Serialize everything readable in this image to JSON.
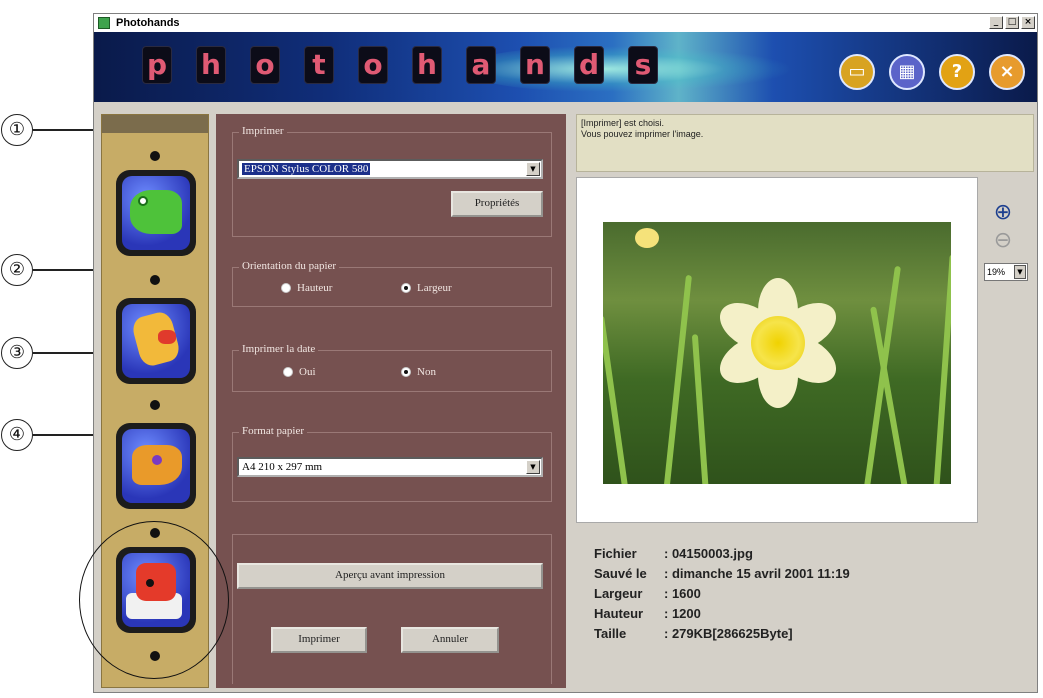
{
  "window": {
    "title": "Photohands",
    "controls": {
      "minimize": "_",
      "maximize": "□",
      "close": "×"
    }
  },
  "banner": {
    "logo_letters": [
      "p",
      "h",
      "o",
      "t",
      "o",
      "h",
      "a",
      "n",
      "d",
      "s"
    ],
    "tools": [
      {
        "name": "open-folder-icon",
        "glyph": "▭",
        "color": "#d8a321"
      },
      {
        "name": "save-icon",
        "glyph": "▦",
        "color": "#5b64c9"
      },
      {
        "name": "help-icon",
        "glyph": "?",
        "color": "#e2a214"
      },
      {
        "name": "close-icon",
        "glyph": "×",
        "color": "#e79b2d"
      }
    ]
  },
  "callouts": [
    "①",
    "②",
    "③",
    "④"
  ],
  "print_panel": {
    "printer": {
      "label": "Imprimer",
      "selected": "EPSON Stylus COLOR 580",
      "properties_button": "Propriétés"
    },
    "orientation": {
      "label": "Orientation du papier",
      "options": [
        "Hauteur",
        "Largeur"
      ],
      "selected": "Largeur"
    },
    "print_date": {
      "label": "Imprimer la date",
      "options": [
        "Oui",
        "Non"
      ],
      "selected": "Non"
    },
    "paper_format": {
      "label": "Format papier",
      "selected": "A4 210 x 297 mm"
    },
    "preview_button": "Aperçu avant impression",
    "print_button": "Imprimer",
    "cancel_button": "Annuler"
  },
  "message": {
    "line1": "[Imprimer] est choisi.",
    "line2": "Vous pouvez imprimer l'image."
  },
  "zoom": {
    "in_glyph": "⊕",
    "out_glyph": "⊖",
    "level": "19%"
  },
  "file_info": [
    {
      "key": "Fichier",
      "value": ": 04150003.jpg"
    },
    {
      "key": "Sauvé le",
      "value": ": dimanche 15 avril 2001 11:19"
    },
    {
      "key": "Largeur",
      "value": ": 1600"
    },
    {
      "key": "Hauteur",
      "value": ": 1200"
    },
    {
      "key": "Taille",
      "value": ": 279KB[286625Byte]"
    }
  ]
}
